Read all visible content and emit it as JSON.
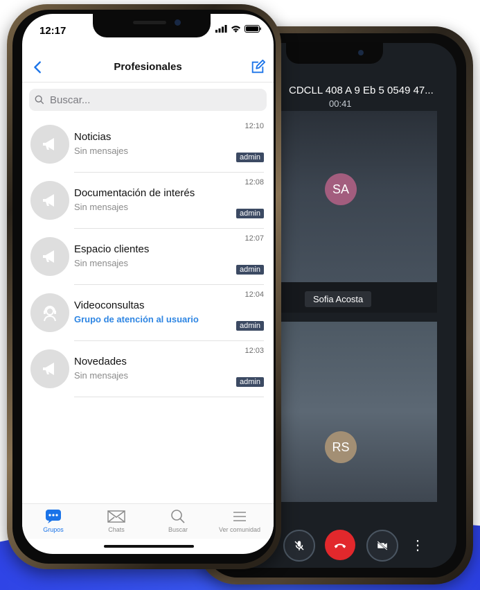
{
  "back_phone": {
    "call_title": "CDCLL 408 A 9 Eb 5 0549 47...",
    "call_timer": "00:41",
    "participant_1_initials": "SA",
    "participant_1_name": "Sofia Acosta",
    "participant_2_initials": "RS",
    "more_glyph": "⋮"
  },
  "front_phone": {
    "status": {
      "time": "12:17"
    },
    "nav": {
      "title": "Profesionales"
    },
    "search": {
      "placeholder": "Buscar..."
    },
    "items": [
      {
        "title": "Noticias",
        "subtitle": "Sin mensajes",
        "time": "12:10",
        "badge": "admin",
        "icon": "megaphone-icon"
      },
      {
        "title": "Documentación de interés",
        "subtitle": "Sin mensajes",
        "time": "12:08",
        "badge": "admin",
        "icon": "megaphone-icon"
      },
      {
        "title": "Espacio clientes",
        "subtitle": "Sin mensajes",
        "time": "12:07",
        "badge": "admin",
        "icon": "megaphone-icon"
      },
      {
        "title": "Videoconsultas",
        "subtitle": "Grupo de atención al usuario",
        "time": "12:04",
        "badge": "admin",
        "icon": "headset-icon"
      },
      {
        "title": "Novedades",
        "subtitle": "Sin mensajes",
        "time": "12:03",
        "badge": "admin",
        "icon": "megaphone-icon"
      }
    ],
    "tabs": [
      {
        "label": "Grupos",
        "active": true
      },
      {
        "label": "Chats"
      },
      {
        "label": "Buscar"
      },
      {
        "label": "Ver comunidad"
      }
    ]
  },
  "colors": {
    "accent": "#1a73e8",
    "badge": "#3c4a63",
    "hangup": "#e2282c"
  }
}
